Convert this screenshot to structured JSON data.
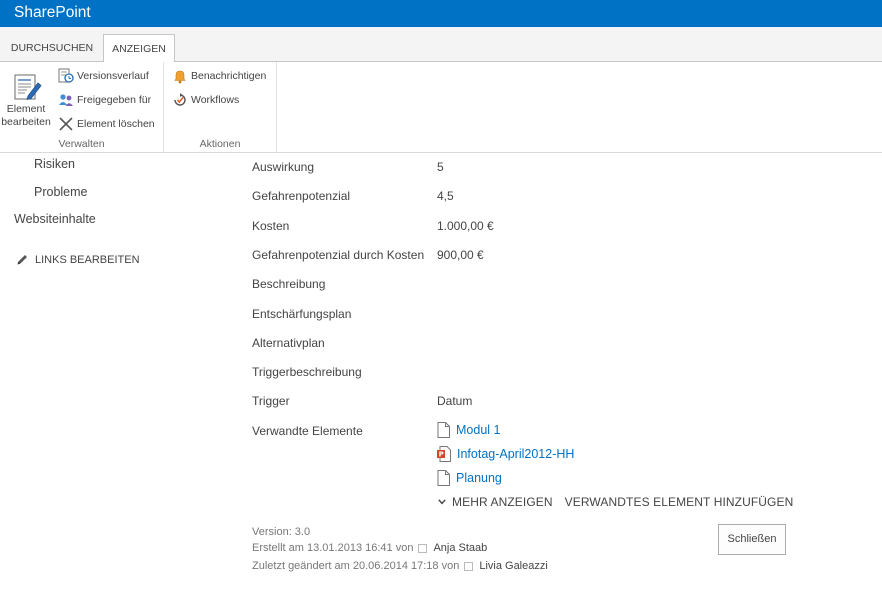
{
  "suitebar": {
    "brand": "SharePoint",
    "color": "#0072c6"
  },
  "ribbon": {
    "tabs": [
      {
        "label": "DURCHSUCHEN",
        "selected": false
      },
      {
        "label": "ANZEIGEN",
        "selected": true
      }
    ],
    "groups": {
      "verwalten": {
        "label": "Verwalten",
        "edit_item_line1": "Element",
        "edit_item_line2": "bearbeiten",
        "version_history": "Versionsverlauf",
        "shared_with": "Freigegeben für",
        "delete_item": "Element löschen"
      },
      "aktionen": {
        "label": "Aktionen",
        "alert_me": "Benachrichtigen",
        "workflows": "Workflows"
      }
    }
  },
  "leftnav": {
    "items": [
      "Risiken",
      "Probleme",
      "Websiteinhalte"
    ],
    "edit_links": "LINKS BEARBEITEN"
  },
  "fields": [
    {
      "label": "Auswirkung",
      "value": "5"
    },
    {
      "label": "Gefahrenpotenzial",
      "value": "4,5"
    },
    {
      "label": "Kosten",
      "value": "1.000,00 €"
    },
    {
      "label": "Gefahrenpotenzial durch Kosten",
      "value": "900,00 €"
    },
    {
      "label": "Beschreibung",
      "value": ""
    },
    {
      "label": "Entschärfungsplan",
      "value": ""
    },
    {
      "label": "Alternativplan",
      "value": ""
    },
    {
      "label": "Triggerbeschreibung",
      "value": ""
    },
    {
      "label": "Trigger",
      "value": "Datum"
    },
    {
      "label": "Verwandte Elemente",
      "value": ""
    }
  ],
  "related": {
    "items": [
      {
        "name": "Modul 1",
        "icon": "document-icon"
      },
      {
        "name": "Infotag-April2012-HH",
        "icon": "powerpoint-icon"
      },
      {
        "name": "Planung",
        "icon": "document-icon"
      }
    ],
    "show_more": "MEHR ANZEIGEN",
    "add_related": "VERWANDTES ELEMENT HINZUFÜGEN",
    "link_color": "#0072c6"
  },
  "meta": {
    "version": "Version: 3.0",
    "created_prefix": "Erstellt am 13.01.2013 16:41  von",
    "created_by": "Anja Staab",
    "modified_prefix": "Zuletzt geändert am 20.06.2014 17:18  von",
    "modified_by": "Livia Galeazzi"
  },
  "close_button": "Schließen"
}
